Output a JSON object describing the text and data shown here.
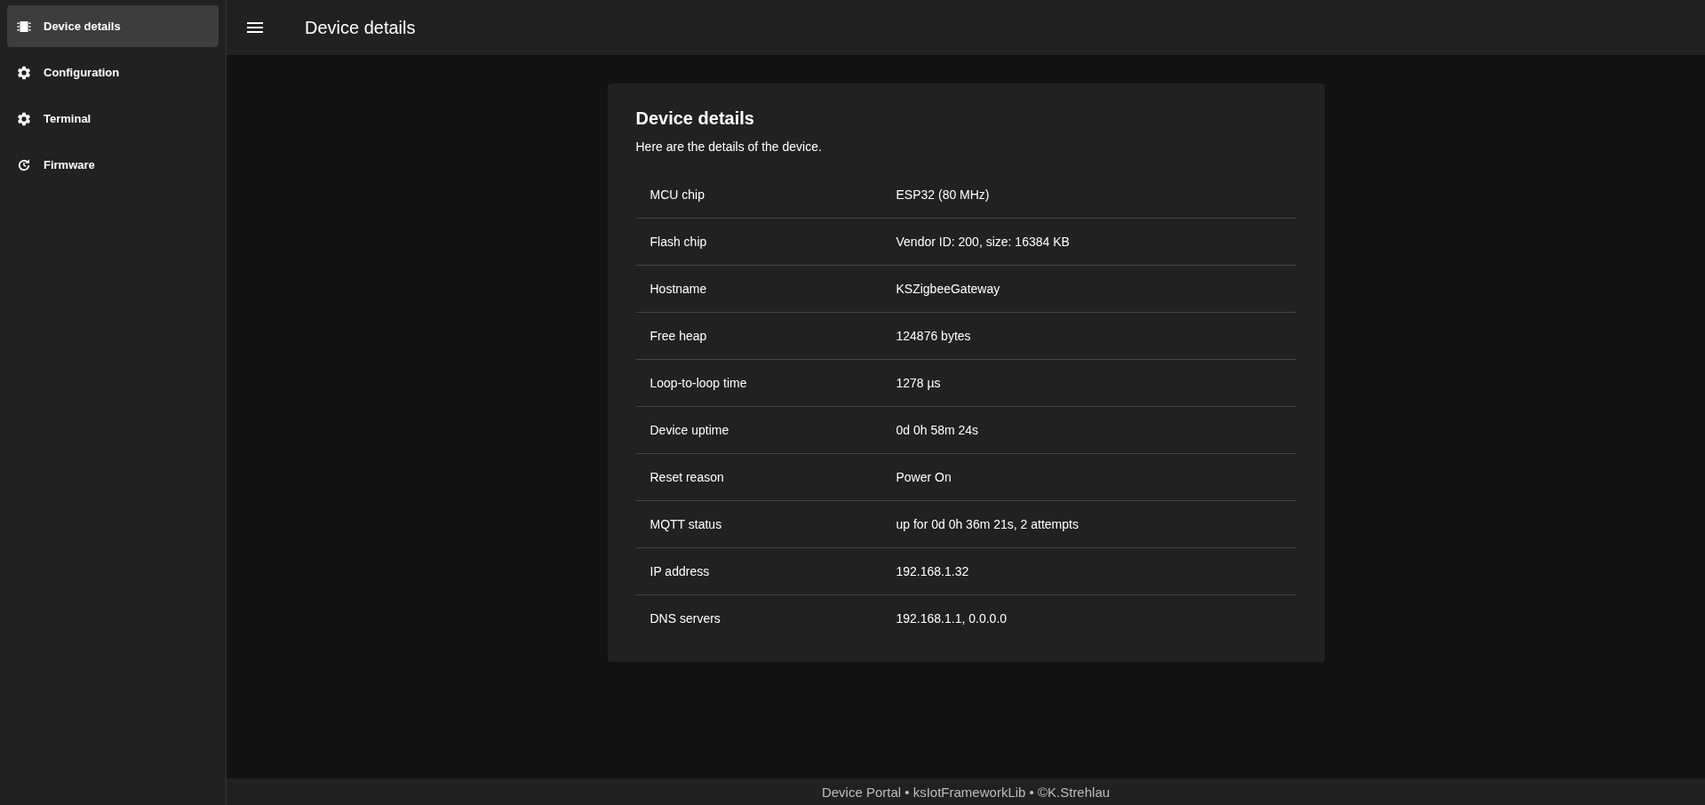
{
  "sidebar": {
    "items": [
      {
        "label": "Device details",
        "selected": true
      },
      {
        "label": "Configuration",
        "selected": false
      },
      {
        "label": "Terminal",
        "selected": false
      },
      {
        "label": "Firmware",
        "selected": false
      }
    ]
  },
  "header": {
    "title": "Device details"
  },
  "card": {
    "title": "Device details",
    "subtitle": "Here are the details of the device.",
    "rows": [
      {
        "label": "MCU chip",
        "value": "ESP32 (80 MHz)"
      },
      {
        "label": "Flash chip",
        "value": "Vendor ID: 200, size: 16384 KB"
      },
      {
        "label": "Hostname",
        "value": "KSZigbeeGateway"
      },
      {
        "label": "Free heap",
        "value": "124876 bytes"
      },
      {
        "label": "Loop-to-loop time",
        "value": "1278 µs"
      },
      {
        "label": "Device uptime",
        "value": "0d 0h 58m 24s"
      },
      {
        "label": "Reset reason",
        "value": "Power On"
      },
      {
        "label": "MQTT status",
        "value": "up for 0d 0h 36m 21s, 2 attempts"
      },
      {
        "label": "IP address",
        "value": "192.168.1.32"
      },
      {
        "label": "DNS servers",
        "value": "192.168.1.1, 0.0.0.0"
      }
    ]
  },
  "footer": {
    "text": "Device Portal • ksIotFrameworkLib • ©K.Strehlau"
  }
}
